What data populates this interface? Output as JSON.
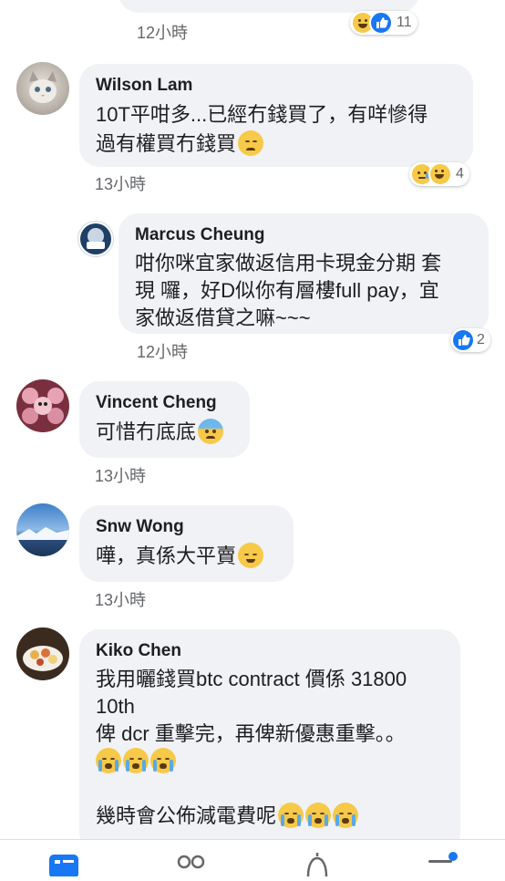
{
  "top_partial": {
    "time": "12小時",
    "reaction_count": "11"
  },
  "comments": [
    {
      "name": "Wilson Lam",
      "text_line1": "10T平咁多...已經冇錢買了，有咩慘得",
      "text_line2": "過有權買冇錢買",
      "time": "13小時",
      "reaction_count": "4"
    },
    {
      "name": "Marcus Cheung",
      "text_line1": "咁你咪宜家做返信用卡現金分期 套",
      "text_line2": "現 囉，好D似你有層樓full pay，宜",
      "text_line3": "家做返借貸之嘛~~~",
      "time": "12小時",
      "reaction_count": "2"
    },
    {
      "name": "Vincent Cheng",
      "text": "可惜冇底底",
      "time": "13小時"
    },
    {
      "name": "Snw Wong",
      "text": "嘩，真係大平賣",
      "time": "13小時"
    },
    {
      "name": "Kiko Chen",
      "text_line1": "我用曬錢買btc contract 價係 31800",
      "text_line2": "10th",
      "text_line3": "俾 dcr 重擊完，再俾新優惠重擊。。",
      "text_line4": "幾時會公佈減電費呢"
    }
  ],
  "icons": {
    "reaction_haha": "haha-emoji-icon",
    "reaction_like": "like-icon",
    "reaction_sad": "sad-emoji-icon",
    "nav_news_feed": "news-feed-icon",
    "nav_friends": "friends-icon",
    "nav_notifications": "bell-icon",
    "nav_menu": "menu-icon"
  },
  "colors": {
    "bubble": "#f0f2f5",
    "like_blue": "#1877f2",
    "emoji_yellow": "#f7c948",
    "time_gray": "#65676b"
  }
}
